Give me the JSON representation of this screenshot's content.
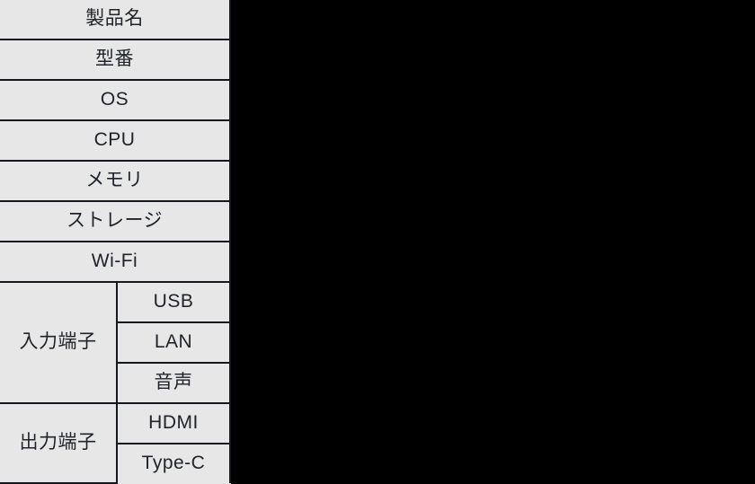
{
  "page": {
    "background_color": "#000000",
    "table_background_color": "#e6e7e6",
    "table_border_color": "#14171c",
    "text_color": "#20232a"
  },
  "spec_table": {
    "simple_rows": [
      {
        "label": "製品名",
        "script": "jp"
      },
      {
        "label": "型番",
        "script": "jp"
      },
      {
        "label": "OS",
        "script": "latin"
      },
      {
        "label": "CPU",
        "script": "latin"
      },
      {
        "label": "メモリ",
        "script": "jp"
      },
      {
        "label": "ストレージ",
        "script": "jp"
      },
      {
        "label": "Wi-Fi",
        "script": "latin"
      }
    ],
    "groups": [
      {
        "label": "入力端子",
        "items": [
          {
            "label": "USB",
            "script": "latin"
          },
          {
            "label": "LAN",
            "script": "latin"
          },
          {
            "label": "音声",
            "script": "jp"
          }
        ]
      },
      {
        "label": "出力端子",
        "items": [
          {
            "label": "HDMI",
            "script": "latin"
          },
          {
            "label": "Type-C",
            "script": "latin"
          }
        ]
      }
    ]
  }
}
